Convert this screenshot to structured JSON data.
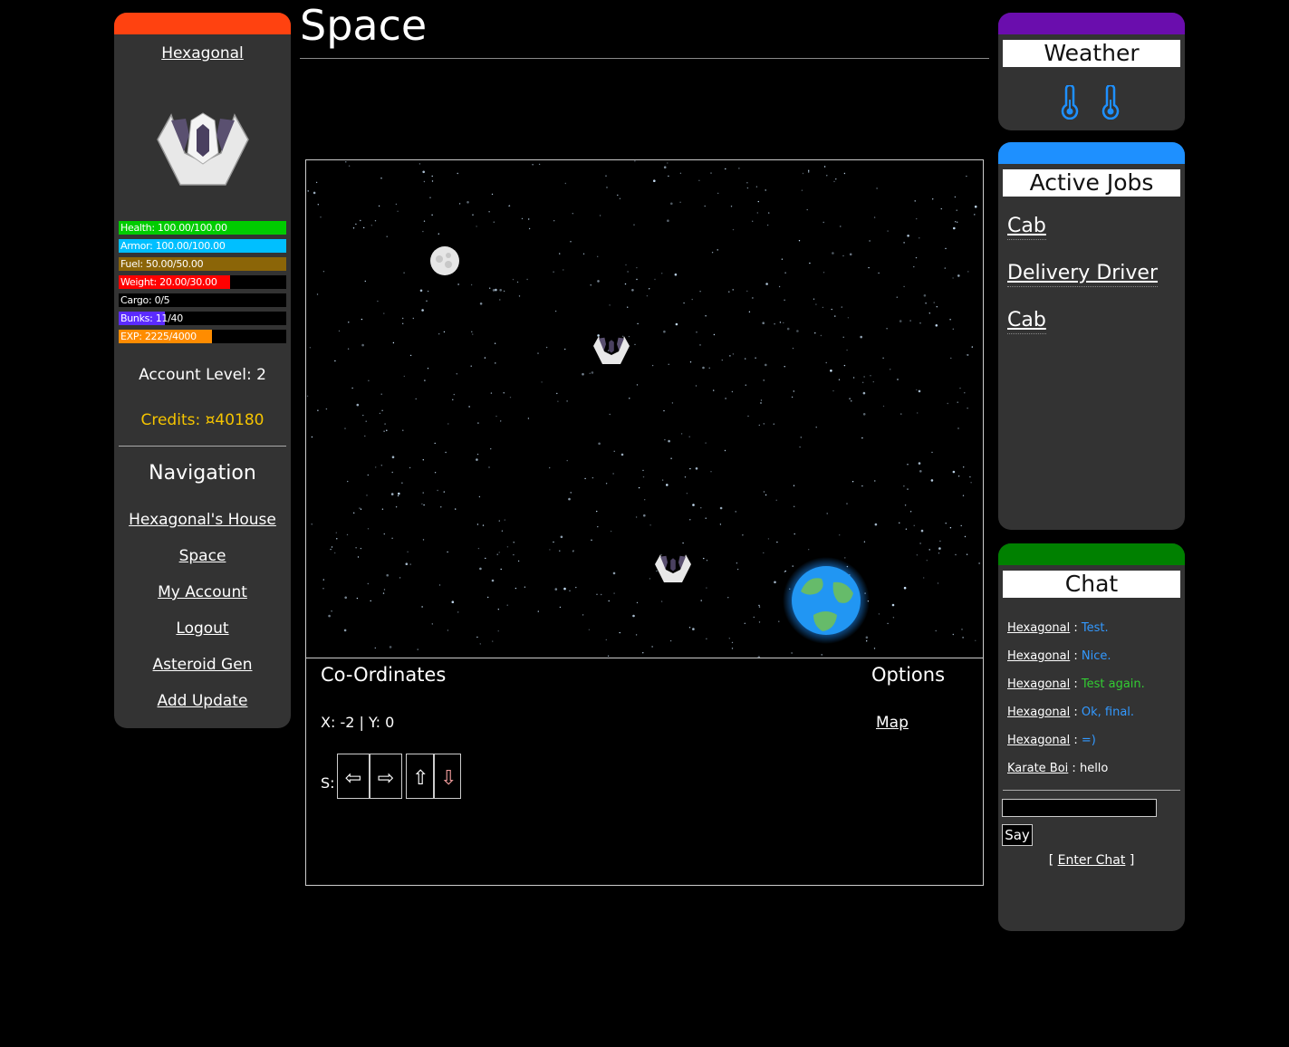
{
  "profile": {
    "username": "Hexagonal",
    "bars": [
      {
        "label": "Health: 100.00/100.00",
        "fraction": 1.0,
        "color": "#00cc00"
      },
      {
        "label": "Armor: 100.00/100.00",
        "fraction": 1.0,
        "color": "#00bfff"
      },
      {
        "label": "Fuel: 50.00/50.00",
        "fraction": 1.0,
        "color": "#8b6508"
      },
      {
        "label": "Weight: 20.00/30.00",
        "fraction": 0.667,
        "color": "#ff0000"
      },
      {
        "label": "Cargo: 0/5",
        "fraction": 0.0,
        "color": "#000000"
      },
      {
        "label": "Bunks: 11/40",
        "fraction": 0.275,
        "color": "#5b2bff"
      },
      {
        "label": "EXP: 2225/4000",
        "fraction": 0.556,
        "color": "#ff8c00"
      }
    ],
    "account_level": "Account Level: 2",
    "credits": "Credits: ¤40180"
  },
  "nav": {
    "title": "Navigation",
    "links": [
      "Hexagonal's House",
      "Space",
      "My Account",
      "Logout",
      "Asteroid Gen",
      "Add Update"
    ]
  },
  "page": {
    "title": "Space"
  },
  "space": {
    "coords_title": "Co-Ordinates",
    "options_title": "Options",
    "coords": "X: -2 | Y: 0",
    "map_link": "Map",
    "speed_label": "S:",
    "arrows": [
      "⇦",
      "⇨",
      "⇧",
      "⇩"
    ]
  },
  "weather": {
    "title": "Weather",
    "icons": [
      "thermometer-icon",
      "thermometer-icon"
    ],
    "accent": "#1e90ff"
  },
  "jobs": {
    "title": "Active Jobs",
    "items": [
      "Cab",
      "Delivery Driver",
      "Cab"
    ]
  },
  "chat": {
    "title": "Chat",
    "messages": [
      {
        "user": "Hexagonal",
        "sep": " : ",
        "text": "Test.",
        "color": "#3399ff"
      },
      {
        "user": "Hexagonal",
        "sep": " : ",
        "text": "Nice.",
        "color": "#3399ff"
      },
      {
        "user": "Hexagonal",
        "sep": " : ",
        "text": "Test again.",
        "color": "#33cc33"
      },
      {
        "user": "Hexagonal",
        "sep": " : ",
        "text": "Ok, final.",
        "color": "#3399ff"
      },
      {
        "user": "Hexagonal",
        "sep": " : ",
        "text": "=)",
        "color": "#3399ff"
      },
      {
        "user": "Karate Boi",
        "sep": " : ",
        "text": "hello",
        "color": "#ffffff"
      }
    ],
    "say_label": "Say",
    "enter_open": "[ ",
    "enter_label": "Enter Chat",
    "enter_close": " ]"
  }
}
